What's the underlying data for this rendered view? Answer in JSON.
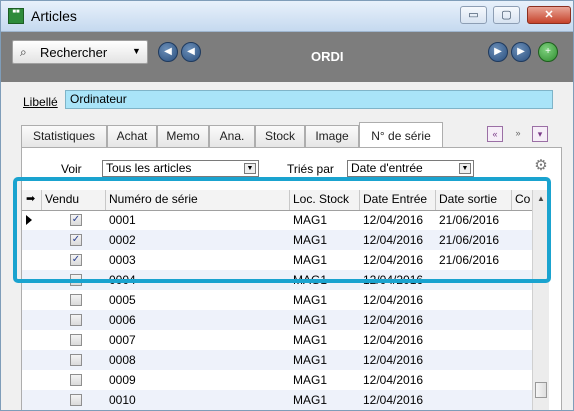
{
  "window": {
    "title": "Articles",
    "close_glyph": "✕",
    "min_glyph": "▭",
    "max_glyph": "▢"
  },
  "toolbar": {
    "search_label": "Rechercher",
    "record_title": "ORDI"
  },
  "libelle": {
    "label": "Libellé",
    "value": "Ordinateur"
  },
  "tabs": [
    {
      "label": "Statistiques"
    },
    {
      "label": "Achat"
    },
    {
      "label": "Memo"
    },
    {
      "label": "Ana."
    },
    {
      "label": "Stock"
    },
    {
      "label": "Image"
    },
    {
      "label": "N° de série",
      "active": true
    }
  ],
  "filters": {
    "voir_label": "Voir",
    "voir_value": "Tous les articles",
    "tries_label": "Triés par",
    "tries_value": "Date d'entrée"
  },
  "grid": {
    "columns": [
      "Vendu",
      "Numéro de série",
      "Loc. Stock",
      "Date Entrée",
      "Date sortie",
      "Co"
    ],
    "rows": [
      {
        "vendu": true,
        "numero": "0001",
        "loc": "MAG1",
        "entree": "12/04/2016",
        "sortie": "21/06/2016"
      },
      {
        "vendu": true,
        "numero": "0002",
        "loc": "MAG1",
        "entree": "12/04/2016",
        "sortie": "21/06/2016"
      },
      {
        "vendu": true,
        "numero": "0003",
        "loc": "MAG1",
        "entree": "12/04/2016",
        "sortie": "21/06/2016"
      },
      {
        "vendu": false,
        "numero": "0004",
        "loc": "MAG1",
        "entree": "12/04/2016",
        "sortie": ""
      },
      {
        "vendu": false,
        "numero": "0005",
        "loc": "MAG1",
        "entree": "12/04/2016",
        "sortie": ""
      },
      {
        "vendu": false,
        "numero": "0006",
        "loc": "MAG1",
        "entree": "12/04/2016",
        "sortie": ""
      },
      {
        "vendu": false,
        "numero": "0007",
        "loc": "MAG1",
        "entree": "12/04/2016",
        "sortie": ""
      },
      {
        "vendu": false,
        "numero": "0008",
        "loc": "MAG1",
        "entree": "12/04/2016",
        "sortie": ""
      },
      {
        "vendu": false,
        "numero": "0009",
        "loc": "MAG1",
        "entree": "12/04/2016",
        "sortie": ""
      },
      {
        "vendu": false,
        "numero": "0010",
        "loc": "MAG1",
        "entree": "12/04/2016",
        "sortie": ""
      }
    ]
  },
  "colors": {
    "toolbar_bg": "#7d7d7d",
    "libelle_bg": "#a9e4f8",
    "highlight": "#1aa3cf",
    "row_alt": "#eef2fa"
  },
  "icons": [
    "app-icon",
    "binoculars-icon",
    "dropdown-arrow-icon",
    "previous-icon",
    "next-icon",
    "add-icon",
    "settings-icon",
    "current-row-arrow-icon"
  ]
}
